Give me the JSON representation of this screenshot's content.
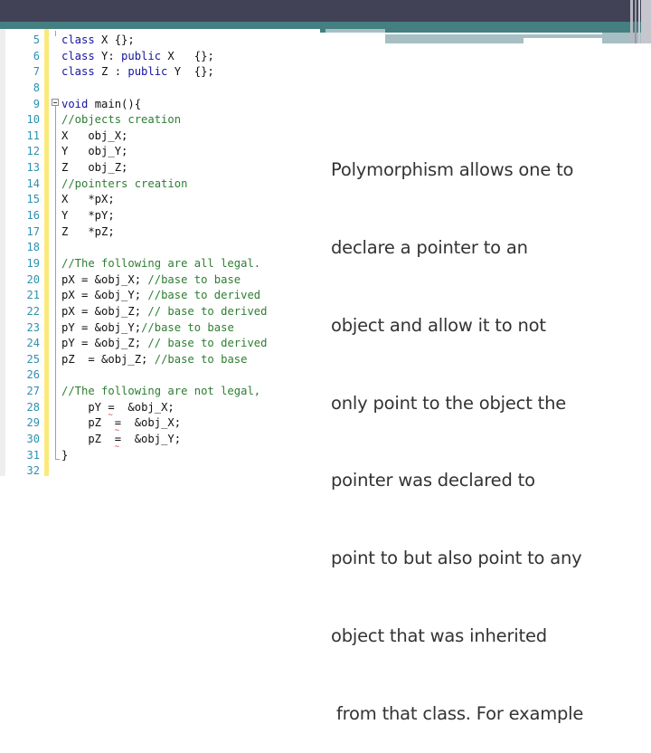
{
  "slide": {
    "colors": {
      "header_dark": "#424256",
      "header_teal": "#447f81",
      "header_light": "#a7bfc2",
      "line_number": "#2b91af",
      "keyword": "#1414a0",
      "comment": "#2e7d32",
      "gutter_highlight": "#fbe97a"
    },
    "body_text": [
      "Polymorphism allows one to",
      "declare a pointer to an",
      "object and allow it to not",
      "only point to the object the",
      "pointer was declared to",
      "point to but also point to any",
      "object that was inherited",
      " from that class. For example"
    ]
  },
  "editor": {
    "lines": [
      {
        "n": "5",
        "code": "class X {};"
      },
      {
        "n": "6",
        "code": "class Y: public X   {};"
      },
      {
        "n": "7",
        "code": "class Z : public Y  {};"
      },
      {
        "n": "8",
        "code": ""
      },
      {
        "n": "9",
        "code": "void main(){"
      },
      {
        "n": "10",
        "code": "//objects creation"
      },
      {
        "n": "11",
        "code": "X   obj_X;"
      },
      {
        "n": "12",
        "code": "Y   obj_Y;"
      },
      {
        "n": "13",
        "code": "Z   obj_Z;"
      },
      {
        "n": "14",
        "code": "//pointers creation"
      },
      {
        "n": "15",
        "code": "X   *pX;"
      },
      {
        "n": "16",
        "code": "Y   *pY;"
      },
      {
        "n": "17",
        "code": "Z   *pZ;"
      },
      {
        "n": "18",
        "code": ""
      },
      {
        "n": "19",
        "code": "//The following are all legal."
      },
      {
        "n": "20",
        "code": "pX = &obj_X; //base to base"
      },
      {
        "n": "21",
        "code": "pX = &obj_Y; //base to derived"
      },
      {
        "n": "22",
        "code": "pX = &obj_Z; // base to derived"
      },
      {
        "n": "23",
        "code": "pY = &obj_Y;//base to base"
      },
      {
        "n": "24",
        "code": "pY = &obj_Z; // base to derived"
      },
      {
        "n": "25",
        "code": "pZ  = &obj_Z; //base to base"
      },
      {
        "n": "26",
        "code": ""
      },
      {
        "n": "27",
        "code": "//The following are not legal,"
      },
      {
        "n": "28",
        "code": "    pY =  &obj_X;"
      },
      {
        "n": "29",
        "code": "    pZ  =  &obj_X;"
      },
      {
        "n": "30",
        "code": "    pZ  =  &obj_Y;"
      },
      {
        "n": "31",
        "code": "}"
      },
      {
        "n": "32",
        "code": ""
      }
    ],
    "error_marker": "~"
  }
}
